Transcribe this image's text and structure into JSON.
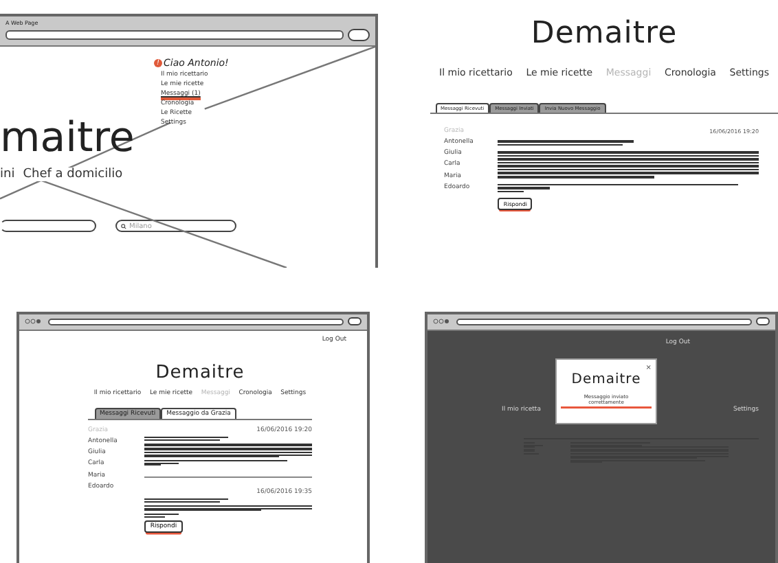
{
  "panels": [
    {
      "kind": "search_page",
      "window": {
        "title": "A Web Page"
      },
      "menu": {
        "badge": "!",
        "greeting": "Ciao Antonio!",
        "items": [
          {
            "label": "Il mio ricettario",
            "selected": false
          },
          {
            "label": "Le mie ricette",
            "selected": false
          },
          {
            "label": "Messaggi (1)",
            "selected": true
          },
          {
            "label": "Cronologia",
            "selected": false
          },
          {
            "label": "Le Ricette",
            "selected": false
          },
          {
            "label": "Settings",
            "selected": false
          }
        ]
      },
      "brand": "maitre",
      "tagline": [
        "ini",
        "Chef a domicilio"
      ],
      "search": {
        "placeholder": "Milano"
      }
    },
    {
      "kind": "inbox_page",
      "brand": "Demaitre",
      "nav": [
        {
          "label": "Il mio ricettario",
          "selected": false
        },
        {
          "label": "Le mie ricette",
          "selected": false
        },
        {
          "label": "Messaggi",
          "selected": true
        },
        {
          "label": "Cronologia",
          "selected": false
        },
        {
          "label": "Settings",
          "selected": false
        }
      ],
      "tabs": [
        {
          "label": "Messaggi Ricevuti",
          "selected": true
        },
        {
          "label": "Messaggi Inviati",
          "selected": false
        },
        {
          "label": "Invia Nuovo Messaggio",
          "selected": false
        }
      ],
      "contacts": [
        {
          "name": "Grazia",
          "selected": true
        },
        {
          "name": "Antonella",
          "selected": false
        },
        {
          "name": "Giulia",
          "selected": false
        },
        {
          "name": "Carla",
          "selected": false
        },
        {
          "name": "Maria",
          "selected": false
        },
        {
          "name": "Edoardo",
          "selected": false
        }
      ],
      "messages": [
        {
          "date": "16/06/2016 19:20"
        }
      ],
      "button": "Rispondi"
    },
    {
      "kind": "thread_page",
      "logout": "Log Out",
      "brand": "Demaitre",
      "nav": [
        {
          "label": "Il mio ricettario",
          "selected": false
        },
        {
          "label": "Le mie ricette",
          "selected": false
        },
        {
          "label": "Messaggi",
          "selected": true
        },
        {
          "label": "Cronologia",
          "selected": false
        },
        {
          "label": "Settings",
          "selected": false
        }
      ],
      "tabs": [
        {
          "label": "Messaggi Ricevuti",
          "selected": false
        },
        {
          "label": "Messaggio da Grazia",
          "selected": true
        }
      ],
      "contacts": [
        {
          "name": "Grazia",
          "selected": true
        },
        {
          "name": "Antonella",
          "selected": false
        },
        {
          "name": "Giulia",
          "selected": false
        },
        {
          "name": "Carla",
          "selected": false
        },
        {
          "name": "Maria",
          "selected": false
        },
        {
          "name": "Edoardo",
          "selected": false
        }
      ],
      "messages": [
        {
          "date": "16/06/2016 19:20"
        },
        {
          "date": "16/06/2016 19:35"
        }
      ],
      "button": "Rispondi"
    },
    {
      "kind": "modal_page",
      "logout": "Log Out",
      "backdrop_nav": [
        "Il mio ricetta",
        "Settings"
      ],
      "modal": {
        "close": "×",
        "brand": "Demaitre",
        "message": "Messaggio inviato correttamente"
      }
    }
  ]
}
